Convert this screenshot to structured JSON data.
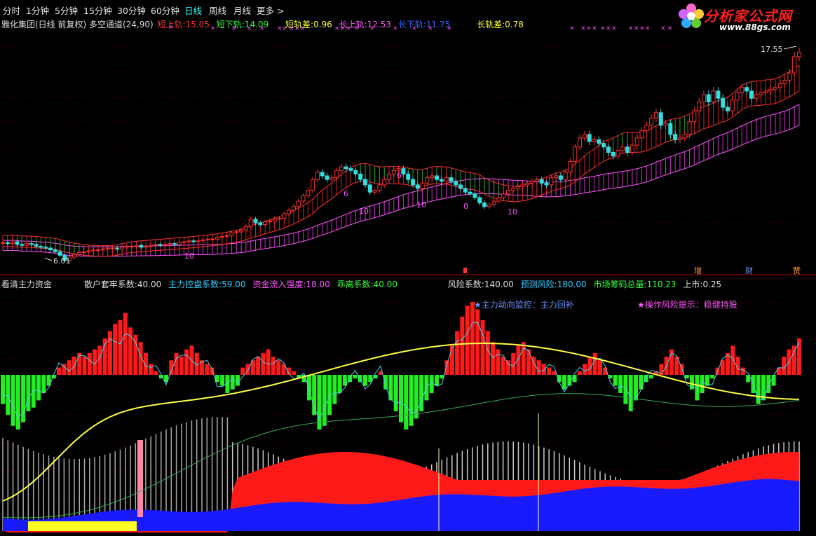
{
  "toolbar": {
    "tabs": [
      "分时",
      "1分钟",
      "5分钟",
      "15分钟",
      "30分钟",
      "60分钟",
      "日线",
      "周线",
      "月线",
      "更多 >"
    ],
    "active": "日线"
  },
  "logo": {
    "brand": "分析家公式网",
    "url": "www.88gs.com"
  },
  "main_legend": {
    "title": "雅化集团(日线 前复权) 多空通道(24,90)",
    "items": [
      {
        "label": "短上轨:",
        "value": "15.05",
        "color": "#ff3030"
      },
      {
        "label": "短下轨:",
        "value": "14.09",
        "color": "#33ff33"
      },
      {
        "label": "短轨差:",
        "value": "0.96",
        "color": "#ffff33"
      },
      {
        "label": "长上轨:",
        "value": "12.53",
        "color": "#ff55ff"
      },
      {
        "label": "长下轨:",
        "value": "11.75",
        "color": "#3366ff"
      },
      {
        "label": "长轨差:",
        "value": "0.78",
        "color": "#ffff33"
      }
    ]
  },
  "sub_legend": {
    "title": "看清主力资金",
    "items": [
      {
        "label": "散户套牢系数:",
        "value": "40.00",
        "color": "#dddddd"
      },
      {
        "label": "主力控盘系数:",
        "value": "59.00",
        "color": "#33ccff"
      },
      {
        "label": "资金流入强度:",
        "value": "18.00",
        "color": "#ff55ff"
      },
      {
        "label": "乖离系数:",
        "value": "40.00",
        "color": "#33ff33"
      },
      {
        "label": "风险系数:",
        "value": "140.00",
        "color": "#dddddd"
      },
      {
        "label": "预测风险:",
        "value": "180.00",
        "color": "#33ccff"
      },
      {
        "label": "市场筹码总量:",
        "value": "110.23",
        "color": "#33ff33"
      },
      {
        "label": "上市:",
        "value": "0.25",
        "color": "#dddddd"
      }
    ],
    "notice1": "★主力动向监控：主力回补",
    "notice2": "★操作风险提示：稳健持股"
  },
  "annotations": {
    "high": "17.55",
    "low": "6.01",
    "labels": [
      "10",
      "10",
      "10",
      "0",
      "10",
      "6",
      "6"
    ],
    "tags": [
      "增",
      "财",
      "赞"
    ],
    "x_mark": "×"
  },
  "chart_data": {
    "type": "candlestick",
    "price_range": [
      5.5,
      18.5
    ],
    "closes": [
      7.0,
      6.95,
      7.05,
      6.9,
      6.85,
      6.95,
      6.9,
      6.8,
      6.75,
      6.7,
      6.6,
      6.5,
      6.3,
      6.01,
      6.2,
      6.35,
      6.45,
      6.5,
      6.55,
      6.6,
      6.6,
      6.65,
      6.7,
      6.7,
      6.65,
      6.75,
      6.8,
      6.8,
      6.85,
      6.75,
      6.8,
      6.85,
      6.9,
      6.85,
      6.9,
      6.95,
      6.9,
      7.0,
      7.05,
      7.1,
      7.05,
      7.1,
      7.15,
      7.2,
      7.2,
      7.3,
      7.35,
      7.4,
      7.55,
      7.6,
      7.7,
      7.9,
      8.3,
      8.1,
      8.0,
      8.15,
      8.2,
      8.3,
      8.35,
      8.6,
      8.8,
      9.0,
      9.3,
      9.6,
      9.9,
      10.5,
      10.9,
      10.7,
      10.5,
      10.6,
      11.0,
      11.2,
      11.1,
      11.0,
      10.8,
      10.5,
      10.2,
      9.8,
      9.9,
      10.2,
      10.5,
      10.8,
      11.0,
      11.1,
      10.8,
      10.5,
      10.2,
      10.0,
      10.3,
      10.6,
      10.7,
      10.5,
      10.4,
      10.6,
      10.4,
      10.2,
      10.0,
      9.8,
      9.7,
      9.5,
      9.2,
      9.0,
      9.1,
      9.3,
      9.5,
      9.7,
      9.9,
      10.0,
      10.1,
      10.2,
      10.3,
      10.4,
      10.5,
      10.3,
      10.2,
      10.6,
      10.7,
      10.5,
      10.9,
      11.5,
      12.3,
      12.8,
      13.0,
      12.6,
      12.7,
      12.5,
      12.3,
      12.0,
      11.8,
      12.1,
      12.3,
      12.0,
      12.4,
      12.8,
      13.2,
      13.5,
      13.9,
      14.2,
      13.5,
      13.6,
      13.0,
      12.7,
      12.8,
      13.0,
      13.7,
      14.3,
      14.8,
      15.2,
      14.8,
      15.4,
      15.0,
      14.5,
      14.3,
      14.9,
      15.3,
      15.6,
      15.4,
      15.0,
      15.2,
      15.3,
      15.4,
      15.5,
      15.6,
      15.8,
      16.0,
      16.4,
      17.3,
      17.55
    ],
    "series": [
      {
        "name": "短上轨",
        "value": 15.05
      },
      {
        "name": "短下轨",
        "value": 14.09
      },
      {
        "name": "长上轨",
        "value": 12.53
      },
      {
        "name": "长下轨",
        "value": 11.75
      }
    ],
    "sub_bars": [
      -16,
      -22,
      -28,
      -30,
      -26,
      -20,
      -18,
      -14,
      -10,
      -6,
      -2,
      4,
      6,
      8,
      10,
      12,
      10,
      12,
      14,
      16,
      20,
      24,
      28,
      30,
      34,
      26,
      22,
      18,
      12,
      6,
      2,
      -2,
      -4,
      8,
      12,
      10,
      14,
      16,
      12,
      8,
      6,
      4,
      -4,
      -6,
      -10,
      -8,
      -6,
      4,
      6,
      8,
      10,
      12,
      14,
      10,
      8,
      6,
      4,
      2,
      -2,
      -4,
      -14,
      -22,
      -30,
      -28,
      -22,
      -16,
      -10,
      -6,
      -4,
      -2,
      -4,
      -6,
      -4,
      -2,
      2,
      -8,
      -14,
      -20,
      -26,
      -30,
      -28,
      -24,
      -20,
      -14,
      -10,
      -6,
      -2,
      8,
      16,
      24,
      32,
      38,
      40,
      36,
      30,
      24,
      18,
      14,
      10,
      8,
      12,
      16,
      18,
      14,
      10,
      8,
      6,
      4,
      2,
      -4,
      -8,
      -6,
      -4,
      2,
      6,
      10,
      12,
      8,
      4,
      -2,
      -6,
      -10,
      -16,
      -20,
      -14,
      -8,
      -4,
      -2,
      2,
      6,
      10,
      14,
      10,
      6,
      -2,
      -8,
      -14,
      -10,
      -6,
      -2,
      4,
      8,
      12,
      16,
      10,
      4,
      -4,
      -10,
      -16,
      -14,
      -10,
      -6,
      4,
      10,
      14,
      16,
      20
    ]
  }
}
